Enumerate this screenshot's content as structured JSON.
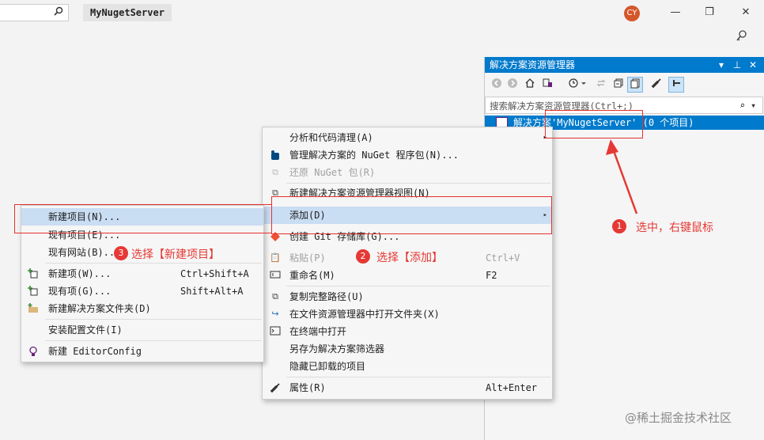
{
  "titlebar": {
    "search_icon": "search-icon",
    "app_name": "MyNugetServer",
    "avatar": "CY",
    "minimize": "—",
    "maximize": "❐",
    "close": "✕"
  },
  "solution_explorer": {
    "title": "解决方案资源管理器",
    "title_buttons": [
      "▾",
      "⊥",
      "✕"
    ],
    "search_placeholder": "搜索解决方案资源管理器(Ctrl+;)",
    "selected_item": "解决方案'MyNugetServer' (0 个项目)"
  },
  "context_menu": {
    "items": [
      {
        "label": "分析和代码清理(A)",
        "submenu": "▸"
      },
      {
        "label": "管理解决方案的 NuGet 程序包(N)..."
      },
      {
        "label": "还原 NuGet 包(R)",
        "disabled": true
      },
      {
        "label": "新建解决方案资源管理器视图(N)"
      },
      {
        "label": "添加(D)",
        "submenu": "▸"
      },
      {
        "label": "创建 Git 存储库(G)..."
      },
      {
        "label": "粘贴(P)",
        "shortcut": "Ctrl+V",
        "disabled": true
      },
      {
        "label": "重命名(M)",
        "shortcut": "F2"
      },
      {
        "label": "复制完整路径(U)"
      },
      {
        "label": "在文件资源管理器中打开文件夹(X)"
      },
      {
        "label": "在终端中打开"
      },
      {
        "label": "另存为解决方案筛选器"
      },
      {
        "label": "隐藏已卸载的项目"
      },
      {
        "label": "属性(R)",
        "shortcut": "Alt+Enter"
      }
    ]
  },
  "submenu": {
    "items": [
      {
        "label": "新建项目(N)..."
      },
      {
        "label": "现有项目(E)..."
      },
      {
        "label": "现有网站(B)..."
      },
      {
        "label": "新建项(W)...",
        "shortcut": "Ctrl+Shift+A"
      },
      {
        "label": "现有项(G)...",
        "shortcut": "Shift+Alt+A"
      },
      {
        "label": "新建解决方案文件夹(D)"
      },
      {
        "label": "安装配置文件(I)"
      },
      {
        "label": "新建 EditorConfig"
      }
    ]
  },
  "annotations": {
    "badge1": "1",
    "note1": "选中，右键鼠标",
    "badge2": "2",
    "note2": "选择【添加】",
    "badge3": "3",
    "note3": "选择【新建项目】"
  },
  "watermark": "@稀土掘金技术社区",
  "colors": {
    "accent": "#007acc",
    "annotation": "#e53935",
    "highlight": "#c9ddf3"
  }
}
